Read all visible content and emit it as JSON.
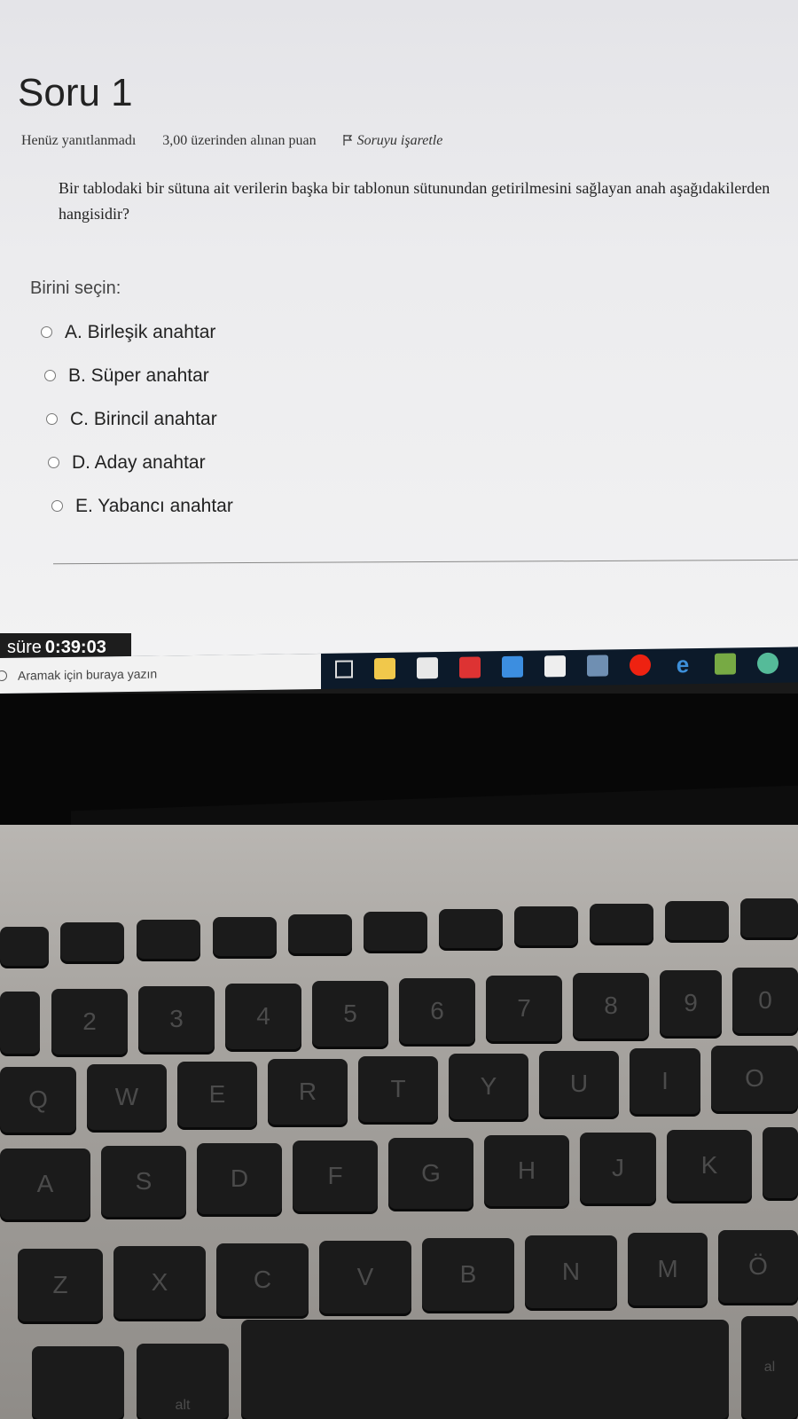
{
  "question": {
    "title": "Soru 1",
    "status": "Henüz yanıtlanmadı",
    "points": "3,00 üzerinden alınan puan",
    "flag_label": "Soruyu işaretle",
    "text": "Bir tablodaki bir sütuna ait verilerin başka bir tablonun sütunundan getirilmesini sağlayan anah aşağıdakilerden hangisidir?",
    "choose_label": "Birini seçin:",
    "options": [
      {
        "label": "A. Birleşik anahtar"
      },
      {
        "label": "B. Süper anahtar"
      },
      {
        "label": "C. Birincil anahtar"
      },
      {
        "label": "D. Aday anahtar"
      },
      {
        "label": "E. Yabancı anahtar"
      }
    ]
  },
  "timer": {
    "label": "süre",
    "value": "0:39:03"
  },
  "taskbar": {
    "search_placeholder": "Aramak için buraya yazın",
    "icons": [
      "task-view-icon",
      "file-explorer-icon",
      "store-icon",
      "gift-icon",
      "mail-icon",
      "photoshop-icon",
      "app-icon",
      "opera-icon",
      "edge-icon",
      "notepad-icon",
      "globe-icon"
    ]
  },
  "keyboard": {
    "row_numbers": [
      "2",
      "3",
      "4",
      "5",
      "6",
      "7",
      "8",
      "9",
      "0"
    ],
    "row_qwerty": [
      "Q",
      "W",
      "E",
      "R",
      "T",
      "Y",
      "U",
      "I",
      "O"
    ],
    "row_asdf": [
      "A",
      "S",
      "D",
      "F",
      "G",
      "H",
      "J",
      "K"
    ],
    "row_zxcv": [
      "Z",
      "X",
      "C",
      "V",
      "B",
      "N",
      "M",
      "Ö"
    ],
    "bottom_left": "alt",
    "bottom_right": "al"
  }
}
